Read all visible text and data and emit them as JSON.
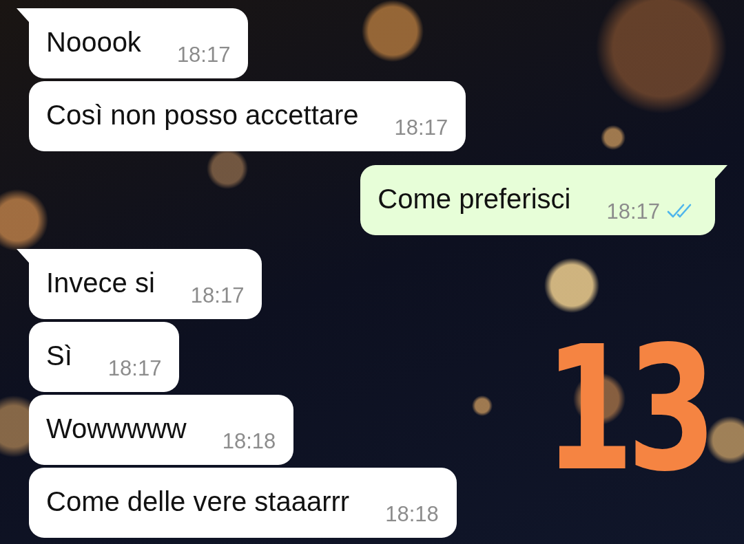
{
  "messages": [
    {
      "kind": "incoming",
      "tail": true,
      "text": "Nooook",
      "time": "18:17"
    },
    {
      "kind": "incoming",
      "tail": false,
      "text": "Così non posso accettare",
      "time": "18:17"
    },
    {
      "kind": "outgoing",
      "tail": true,
      "text": "Come preferisci",
      "time": "18:17",
      "read": true
    },
    {
      "kind": "incoming",
      "tail": true,
      "text": "Invece si",
      "time": "18:17"
    },
    {
      "kind": "incoming",
      "tail": false,
      "text": "Sì",
      "time": "18:17"
    },
    {
      "kind": "incoming",
      "tail": false,
      "text": "Wowwwww",
      "time": "18:18"
    },
    {
      "kind": "incoming",
      "tail": false,
      "text": "Come delle vere staaarrr",
      "time": "18:18"
    }
  ],
  "annotation": {
    "text": "13"
  }
}
